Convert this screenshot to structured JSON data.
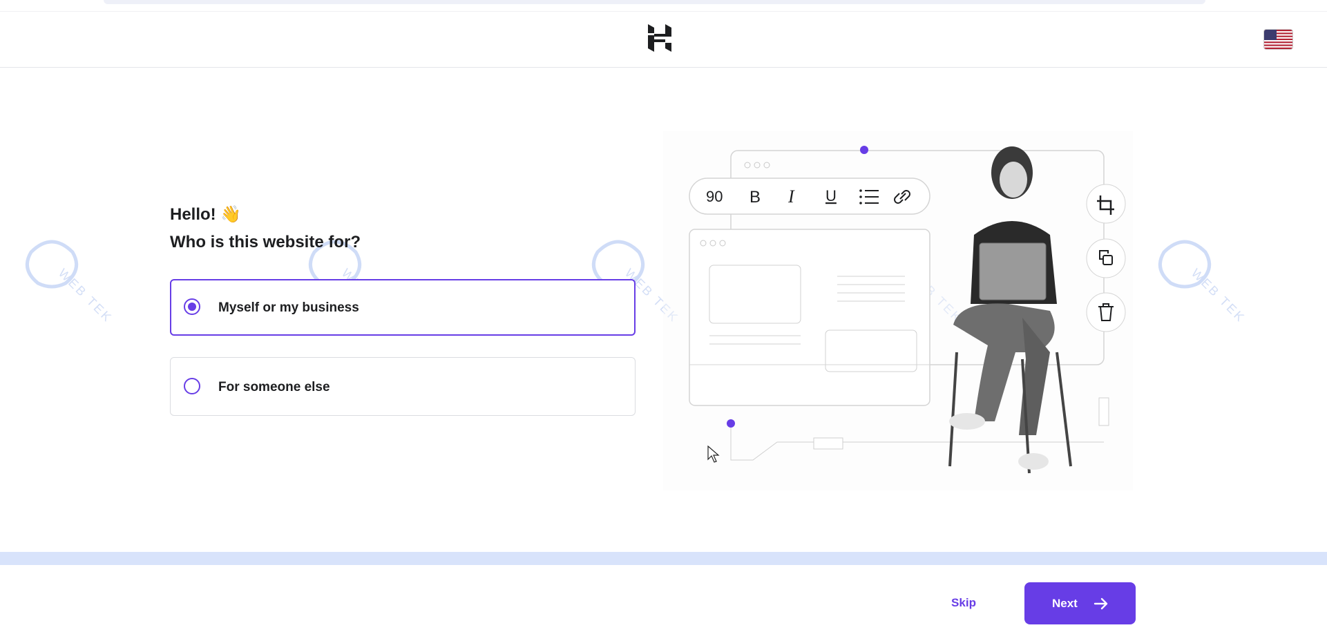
{
  "header": {
    "logo_icon": "hostinger-logo-icon",
    "language_flag": "us-flag-icon"
  },
  "onboarding": {
    "greeting": "Hello! 👋",
    "question": "Who is this website for?",
    "options": [
      {
        "label": "Myself or my business",
        "selected": true
      },
      {
        "label": "For someone else",
        "selected": false
      }
    ]
  },
  "illustration": {
    "toolbar_font_size": "90",
    "toolbar_buttons": [
      "bold-icon",
      "italic-icon",
      "underline-icon",
      "list-icon",
      "link-icon"
    ],
    "side_buttons": [
      "crop-icon",
      "copy-icon",
      "trash-icon"
    ]
  },
  "watermark": {
    "text": "WEB TEK"
  },
  "footer": {
    "skip_label": "Skip",
    "next_label": "Next"
  },
  "colors": {
    "accent": "#673de6",
    "progress_bar": "#d8e3fb",
    "text": "#1d1e20"
  }
}
